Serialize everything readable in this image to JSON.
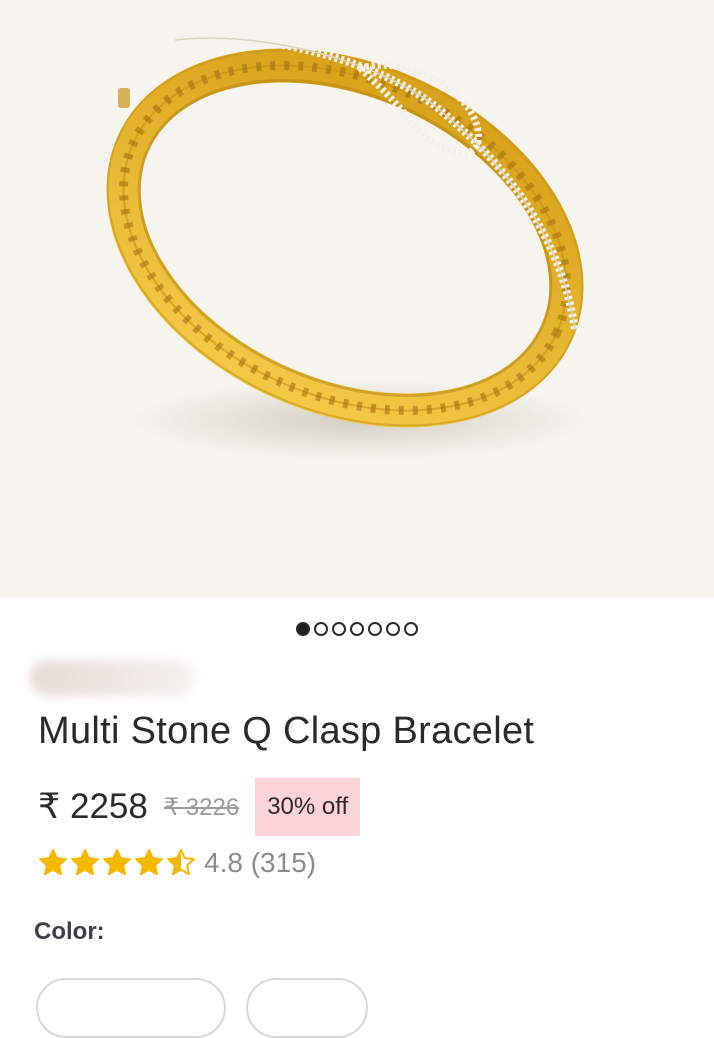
{
  "product": {
    "name": "Multi Stone Q Clasp Bracelet",
    "price": "₹ 2258",
    "mrp": "₹ 3226",
    "discount": "30% off",
    "rating": "4.8",
    "review_count": "(315)",
    "rating_stars": 4.5
  },
  "gallery": {
    "slide_count": 7,
    "active_slide": 1
  },
  "variants": {
    "color_label": "Color:"
  },
  "colors": {
    "star": "#f5b800",
    "discount_bg": "#fbd3d8",
    "gold": "#e2b12b"
  }
}
